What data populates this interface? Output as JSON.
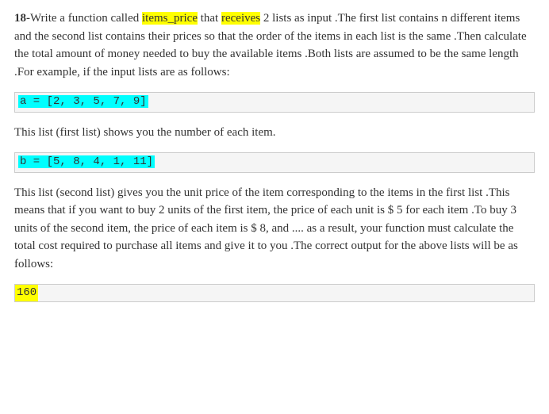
{
  "question": {
    "number": "18-",
    "intro_1": "Write a function called ",
    "highlight_1": "items_price",
    "intro_2": " that ",
    "highlight_2": "receives",
    "intro_3": " 2 lists as input .The first list contains n different items and the second list contains their prices so that the order of the items in each list is the same .Then calculate the total amount of money needed to buy the available items .Both lists are assumed to be the same length .For example, if the input lists are as follows:"
  },
  "code_a": "a = [2, 3, 5, 7, 9]",
  "para_1": "This list (first list) shows you the number of each item.",
  "code_b": "b = [5, 8, 4, 1, 11]",
  "para_2": "This list (second list) gives you the unit price of the item corresponding to the items in the first list .This means that if you want to buy 2 units of the first item, the price of each unit is $ 5 for each item .To buy 3 units of the second item, the price of each item is $ 8, and .... as a result, your function must calculate the total cost required to purchase all items and give it to you .The correct output for the above lists will be as follows:",
  "output": "160"
}
